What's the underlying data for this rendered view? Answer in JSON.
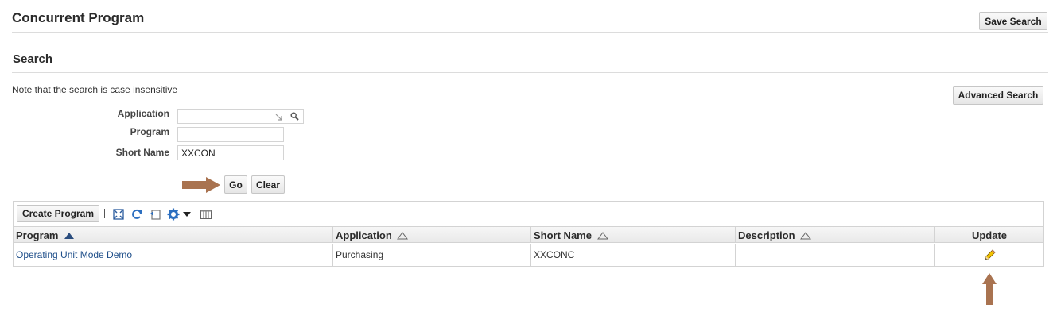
{
  "header": {
    "title": "Concurrent Program",
    "save_search": "Save Search"
  },
  "search": {
    "title": "Search",
    "note": "Note that the search is case insensitive",
    "advanced_search": "Advanced Search",
    "fields": {
      "application": {
        "label": "Application",
        "value": ""
      },
      "program": {
        "label": "Program",
        "value": ""
      },
      "short_name": {
        "label": "Short Name",
        "value": "XXCON"
      }
    },
    "go": "Go",
    "clear": "Clear"
  },
  "results": {
    "create_button": "Create Program",
    "columns": [
      {
        "label": "Program",
        "sort": "ascending"
      },
      {
        "label": "Application",
        "sort": "unsorted"
      },
      {
        "label": "Short Name",
        "sort": "unsorted"
      },
      {
        "label": "Description",
        "sort": "unsorted"
      },
      {
        "label": "Update",
        "sort": "none"
      }
    ],
    "rows": [
      {
        "program": "Operating Unit Mode Demo",
        "application": "Purchasing",
        "short_name": "XXCONC",
        "description": ""
      }
    ]
  },
  "icons": {
    "toolbar": [
      "detach-icon",
      "refresh-icon",
      "reset-icon",
      "settings-icon",
      "dropdown-icon",
      "columns-icon"
    ],
    "row_update": "pencil-icon"
  },
  "colors": {
    "link": "#1f4f8a",
    "annotation_arrow": "#a97350",
    "settings_icon": "#2c6fc0"
  }
}
